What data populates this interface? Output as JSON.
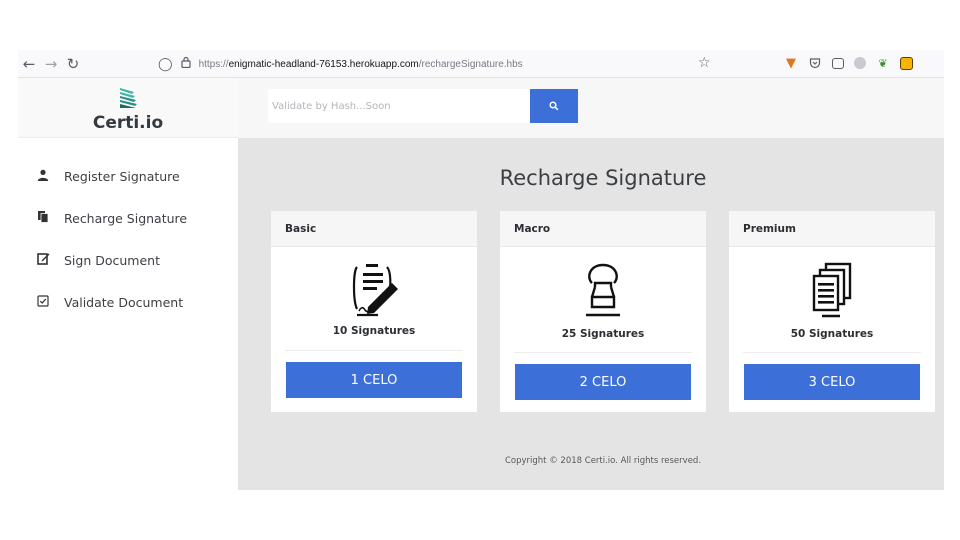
{
  "browser": {
    "back_icon": "arrow-left-icon",
    "forward_icon": "arrow-right-icon",
    "reload_icon": "reload-icon",
    "url_scheme": "https://",
    "url_host": "enigmatic-headland-76153.herokuapp.com",
    "url_path": "/rechargeSignature.hbs"
  },
  "brand": {
    "name": "Certi.io"
  },
  "sidebar": {
    "items": [
      {
        "label": "Register Signature",
        "icon": "user-icon"
      },
      {
        "label": "Recharge Signature",
        "icon": "copy-icon"
      },
      {
        "label": "Sign Document",
        "icon": "edit-icon"
      },
      {
        "label": "Validate Document",
        "icon": "checkbox-icon"
      }
    ]
  },
  "search": {
    "placeholder": "Validate by Hash...Soon"
  },
  "main": {
    "title": "Recharge Signature"
  },
  "plans": [
    {
      "name": "Basic",
      "signatures": "10 Signatures",
      "price": "1 CELO",
      "icon": "signed-document-icon"
    },
    {
      "name": "Macro",
      "signatures": "25 Signatures",
      "price": "2 CELO",
      "icon": "stamp-icon"
    },
    {
      "name": "Premium",
      "signatures": "50 Signatures",
      "price": "3 CELO",
      "icon": "document-stack-icon"
    }
  ],
  "footer": {
    "text": "Copyright © 2018 Certi.io. All rights reserved."
  },
  "colors": {
    "accent": "#3d6fd9",
    "sidebar_bg": "#ffffff",
    "main_bg": "#e4e4e4",
    "logo_teal": "#3fb7a3"
  }
}
